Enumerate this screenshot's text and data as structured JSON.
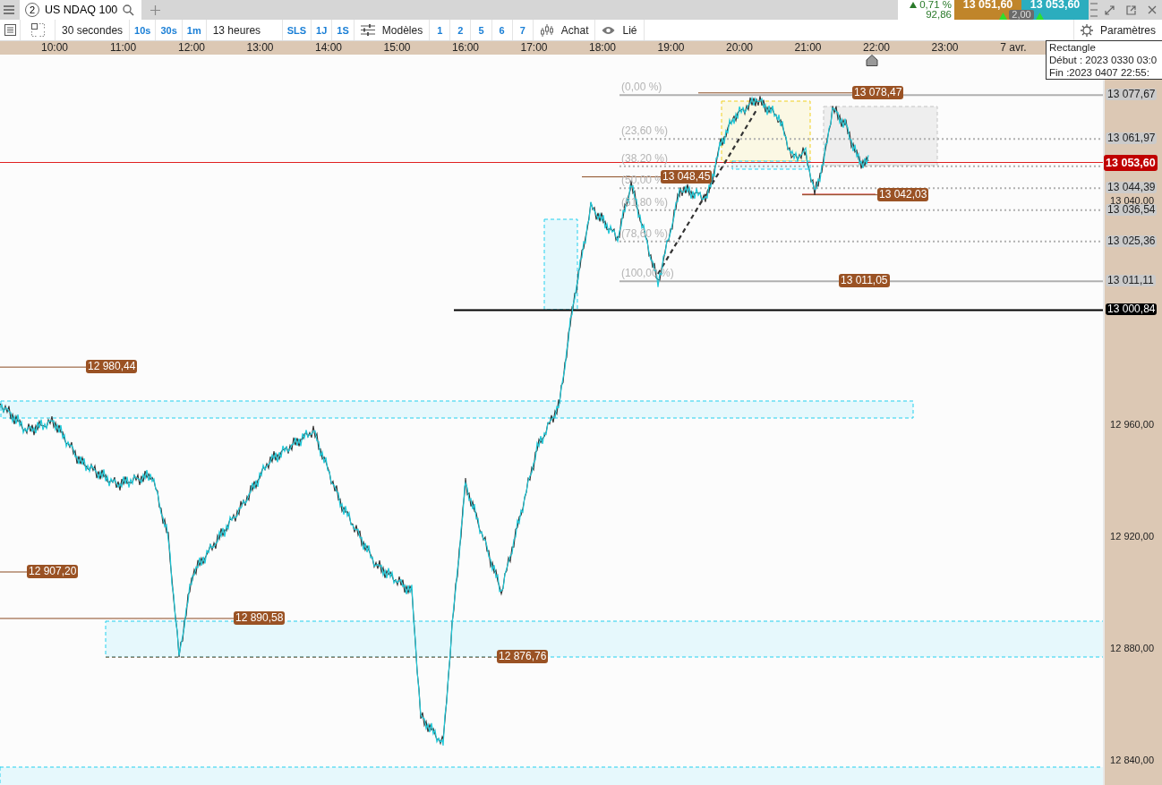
{
  "tab": {
    "number": "2",
    "label": "US NDAQ 100",
    "selected": true
  },
  "quote": {
    "change": "0,71 %",
    "change_points": "92,86",
    "bid": "13 051,60",
    "ask": "13 053,60",
    "spread": "2,00"
  },
  "toolbar": {
    "period": "30 secondes",
    "period_shortcuts": [
      "10s",
      "30s",
      "1m"
    ],
    "range": "13 heures",
    "range_shortcuts": [
      "SLS",
      "1J",
      "1S"
    ],
    "templates": "Modèles",
    "template_shortcuts": [
      "1",
      "2",
      "5",
      "6",
      "7"
    ],
    "order": "Achat",
    "link": "Lié",
    "settings": "Paramètres"
  },
  "time_axis": [
    "10:00",
    "11:00",
    "12:00",
    "13:00",
    "14:00",
    "15:00",
    "16:00",
    "17:00",
    "18:00",
    "19:00",
    "20:00",
    "21:00",
    "22:00",
    "23:00",
    "7 avr."
  ],
  "tooltip": [
    "Rectangle",
    "Début : 2023 0330 03:0",
    "Fin :2023 0407 22:55:"
  ],
  "price_ticks": [
    "13 040,00",
    "12 960,00",
    "12 920,00",
    "12 880,00",
    "12 840,00"
  ],
  "axis_tags": [
    {
      "kind": "level",
      "price": "13 077,67"
    },
    {
      "kind": "level",
      "price": "13 061,97"
    },
    {
      "kind": "current",
      "price": "13 053,60"
    },
    {
      "kind": "level",
      "price": "13 044,39"
    },
    {
      "kind": "level",
      "price": "13 036,54"
    },
    {
      "kind": "level",
      "price": "13 025,36"
    },
    {
      "kind": "level",
      "price": "13 011,11"
    },
    {
      "kind": "line",
      "price": "13 000,84"
    }
  ],
  "fibonacci": [
    "(0,00 %)",
    "(23,60 %)",
    "(38,20 %)",
    "(50,00 %",
    "(61,80 %)",
    "(78,60 %)",
    "(100,00 %)"
  ],
  "price_labels": [
    "13 078,47",
    "13 048,45",
    "13 042,03",
    "13 011,05",
    "12 980,44",
    "12 907,20",
    "12 890,58",
    "12 876,76"
  ]
}
